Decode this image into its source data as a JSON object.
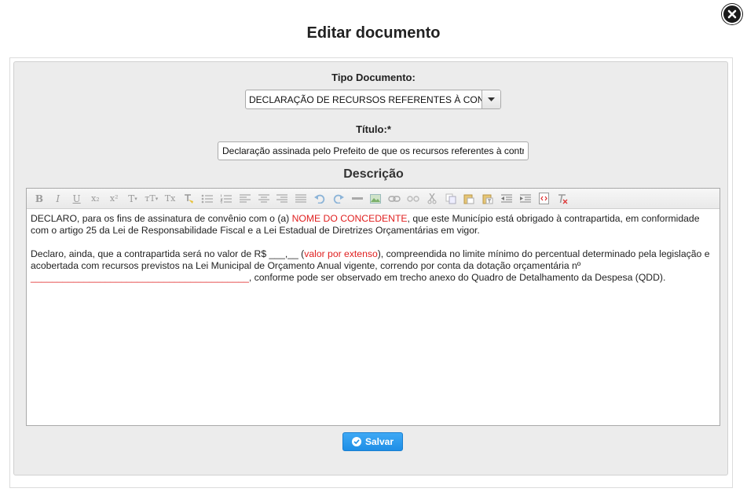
{
  "dialog": {
    "title": "Editar documento",
    "save_label": "Salvar"
  },
  "form": {
    "tipo_label": "Tipo Documento:",
    "tipo_value": "DECLARAÇÃO DE RECURSOS REFERENTES À CONTRAPARTIDA",
    "titulo_label": "Título:*",
    "titulo_value": "Declaração assinada pelo Prefeito de que os recursos referentes à contrapartida",
    "descricao_label": "Descrição"
  },
  "toolbar": {
    "buttons": [
      "B",
      "I",
      "U",
      "x₂",
      "x²",
      "T",
      "тT",
      "Tx"
    ],
    "icons": [
      "bold-icon",
      "italic-icon",
      "underline-icon",
      "subscript-icon",
      "superscript-icon",
      "font-icon",
      "font-size-icon",
      "remove-format-icon",
      "paste-format-icon",
      "bulleted-list-icon",
      "numbered-list-icon",
      "align-left-icon",
      "align-center-icon",
      "align-right-icon",
      "justify-icon",
      "undo-icon",
      "redo-icon",
      "horizontal-rule-icon",
      "image-icon",
      "link-icon",
      "unlink-icon",
      "cut-icon",
      "copy-icon",
      "paste-icon",
      "paste-text-icon",
      "outdent-icon",
      "indent-icon",
      "source-code-icon",
      "clear-format-icon"
    ]
  },
  "content": {
    "p1_a": "DECLARO, para os fins de assinatura de convênio com o (a) ",
    "p1_red": "NOME DO CONCEDENTE",
    "p1_b": ", que este Município está obrigado à contrapartida, em conformidade com o artigo 25 da Lei de Responsabilidade Fiscal e a Lei Estadual de Diretrizes Orçamentárias em vigor.",
    "p2_a": "Declaro, ainda, que a contrapartida será no valor de R$ ___,__ (",
    "p2_red1": "valor por extenso",
    "p2_b": "), compreendida no limite mínimo do percentual determinado pela legislação e acobertada com recursos previstos na Lei Municipal de Orçamento Anual vigente, correndo por conta da dotação orçamentária nº ",
    "p2_red2": "_________________________________________",
    "p2_c": ", conforme pode ser observado em trecho anexo do Quadro de Detalhamento da Despesa (QDD)."
  },
  "colors": {
    "accent": "#2b9bef",
    "highlight_red": "#e02020"
  }
}
